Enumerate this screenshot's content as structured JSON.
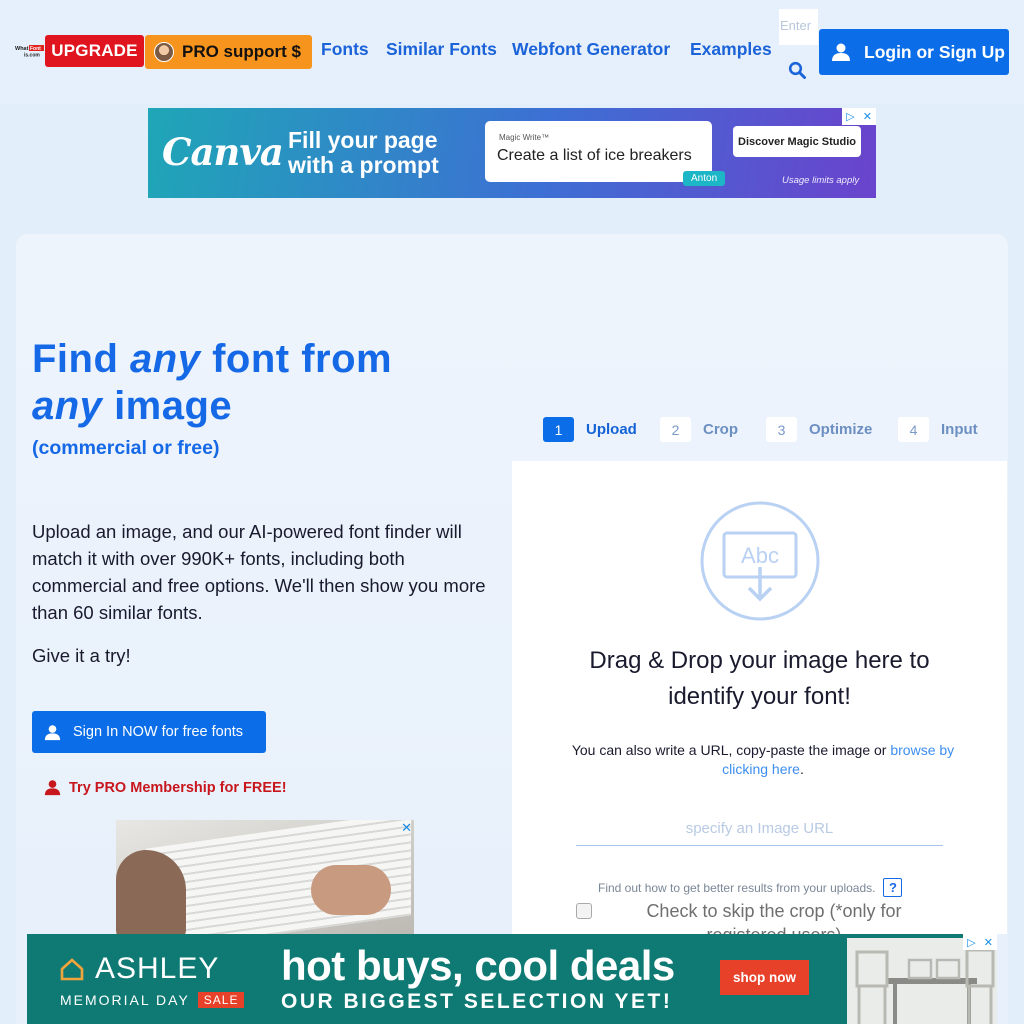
{
  "header": {
    "logo_text": "WhatFontIs.com",
    "upgrade_label": "UPGRADE",
    "pro_support_label": "PRO support $",
    "nav": [
      {
        "label": "Fonts"
      },
      {
        "label": "Similar Fonts"
      },
      {
        "label": "Webfont Generator"
      },
      {
        "label": "Examples"
      }
    ],
    "search_placeholder": "Enter",
    "login_label": "Login or Sign Up",
    "colors": {
      "primary": "#0b6ee8",
      "upgrade": "#e0141e",
      "pro": "#f7941d"
    }
  },
  "ad_top": {
    "brand": "Canva",
    "headline_line1": "Fill your page",
    "headline_line2": "with a prompt",
    "card_tag": "Magic Write™",
    "card_text": "Create a list of ice breakers",
    "card_user": "Anton",
    "cta": "Discover Magic Studio",
    "disclaimer": "Usage limits apply"
  },
  "hero": {
    "title_word1": "Find",
    "title_any1": "any",
    "title_word2": "font from",
    "title_any2": "any",
    "title_word3": "image",
    "subtitle": "(commercial or free)",
    "description": "Upload an image, and our AI-powered font finder will match it with over 990K+ fonts, including both commercial and free options. We'll then show you more than 60 similar fonts.",
    "try_text": "Give it a try!",
    "signin_label": "Sign In NOW for free fonts",
    "pro_free_label": "Try PRO Membership for FREE!"
  },
  "steps": [
    {
      "num": "1",
      "label": "Upload",
      "active": true
    },
    {
      "num": "2",
      "label": "Crop",
      "active": false
    },
    {
      "num": "3",
      "label": "Optimize",
      "active": false
    },
    {
      "num": "4",
      "label": "Input",
      "active": false
    }
  ],
  "upload": {
    "icon": "abc-download-icon",
    "title_line1": "Drag & Drop your image here to",
    "title_line2": "identify your font!",
    "hint_prefix": "You can also write a URL, copy-paste the image or",
    "hint_link": "browse by clicking here",
    "hint_suffix": ".",
    "url_placeholder": "specify an Image URL",
    "tip_text": "Find out how to get better results from your uploads.",
    "tip_button": "?",
    "skip_label": "Check to skip the crop (*only for registered users)"
  },
  "ad_bottom": {
    "brand": "ASHLEY",
    "event": "MEMORIAL DAY",
    "sale_tag": "SALE",
    "headline": "hot buys, cool deals",
    "subline": "OUR BIGGEST SELECTION YET!",
    "cta": "shop now"
  }
}
